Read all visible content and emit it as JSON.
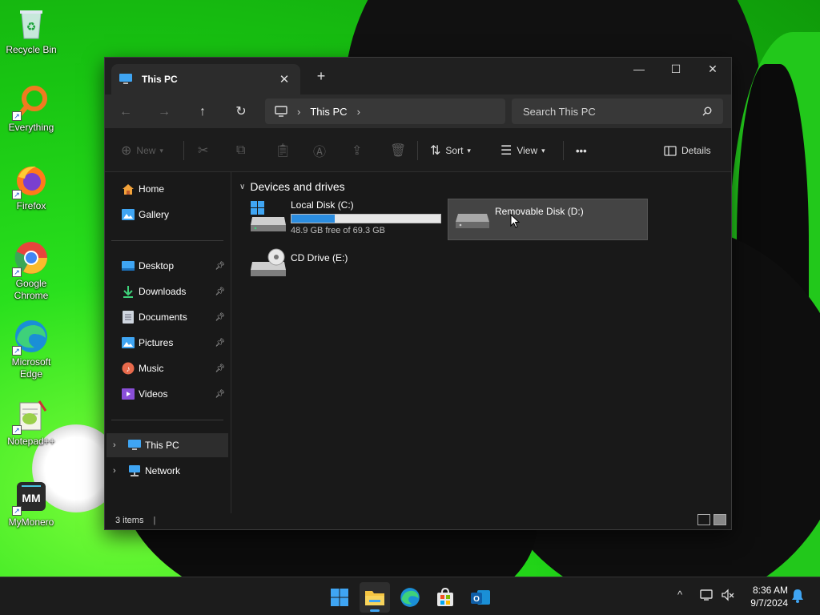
{
  "desktop": {
    "icons": [
      {
        "label": "Recycle Bin",
        "icon": "recycle-bin-icon"
      },
      {
        "label": "Everything",
        "icon": "everything-search-icon"
      },
      {
        "label": "Firefox",
        "icon": "firefox-icon"
      },
      {
        "label": "Google Chrome",
        "icon": "chrome-icon"
      },
      {
        "label": "Microsoft Edge",
        "icon": "edge-icon"
      },
      {
        "label": "Notepad++",
        "icon": "notepadpp-icon"
      },
      {
        "label": "MyMonero",
        "icon": "mymonero-icon"
      }
    ],
    "mymonero_logo_text": "MM"
  },
  "window": {
    "tab_title": "This PC",
    "tab_close": "✕",
    "new_tab": "+",
    "caption": {
      "minimize": "—",
      "maximize": "☐",
      "close": "✕"
    },
    "nav": {
      "back": "←",
      "forward": "→",
      "up": "↑",
      "refresh": "↻"
    },
    "address": {
      "crumb": "This PC",
      "chevron": "›"
    },
    "search": {
      "placeholder": "Search This PC",
      "icon": "search-icon"
    },
    "toolbar": {
      "new_label": "New",
      "sort_label": "Sort",
      "view_label": "View",
      "more_label": "•••",
      "details_label": "Details"
    },
    "sidebar": {
      "home": "Home",
      "gallery": "Gallery",
      "pinned": [
        {
          "label": "Desktop"
        },
        {
          "label": "Downloads"
        },
        {
          "label": "Documents"
        },
        {
          "label": "Pictures"
        },
        {
          "label": "Music"
        },
        {
          "label": "Videos"
        }
      ],
      "this_pc": "This PC",
      "network": "Network"
    },
    "content": {
      "group_title": "Devices and drives",
      "drives": [
        {
          "name": "Local Disk (C:)",
          "free_text": "48.9 GB free of 69.3 GB",
          "used_fraction": 0.29
        },
        {
          "name": "Removable Disk (D:)"
        },
        {
          "name": "CD Drive (E:)"
        }
      ]
    },
    "status": {
      "items": "3 items"
    }
  },
  "taskbar": {
    "clock_time": "8:36 AM",
    "clock_date": "9/7/2024",
    "tray_chevron": "^"
  },
  "colors": {
    "accent": "#2b8de0",
    "window_bg": "#191919",
    "wallpaper": "#2ee62a"
  }
}
